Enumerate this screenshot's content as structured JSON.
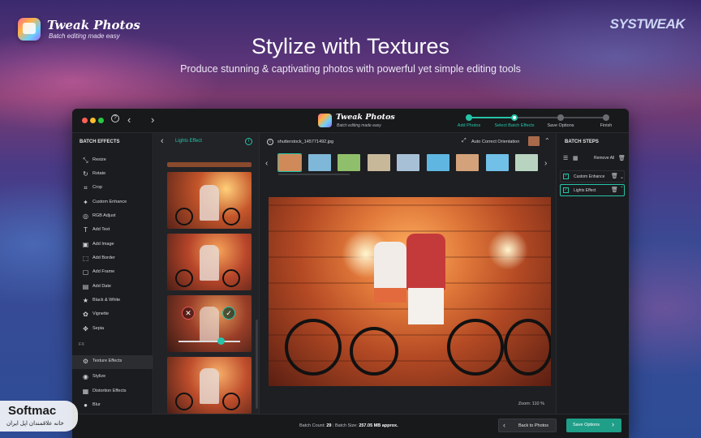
{
  "brand": {
    "name": "Tweak Photos",
    "tagline": "Batch editing made easy",
    "vendor": "SYSTWEAK"
  },
  "hero": {
    "title": "Stylize with Textures",
    "subtitle": "Produce stunning & captivating photos with powerful yet simple editing tools"
  },
  "window": {
    "app_name": "Tweak Photos",
    "app_tagline": "Batch editing made easy",
    "steps": [
      {
        "label": "Add Photos",
        "state": "done"
      },
      {
        "label": "Select Batch Effects",
        "state": "current"
      },
      {
        "label": "Save Options",
        "state": "todo"
      },
      {
        "label": "Finish",
        "state": "todo"
      }
    ],
    "left": {
      "title": "BATCH EFFECTS",
      "tools": [
        {
          "label": "Resize",
          "icon": "resize-icon"
        },
        {
          "label": "Rotate",
          "icon": "rotate-icon"
        },
        {
          "label": "Crop",
          "icon": "crop-icon"
        },
        {
          "label": "Custom Enhance",
          "icon": "enhance-icon"
        },
        {
          "label": "RGB Adjust",
          "icon": "rgb-icon"
        },
        {
          "label": "Add Text",
          "icon": "text-icon"
        },
        {
          "label": "Add Image",
          "icon": "image-icon"
        },
        {
          "label": "Add Border",
          "icon": "border-icon"
        },
        {
          "label": "Add Frame",
          "icon": "frame-icon"
        },
        {
          "label": "Add Date",
          "icon": "calendar-icon"
        },
        {
          "label": "Black & White",
          "icon": "contrast-icon"
        },
        {
          "label": "Vignette",
          "icon": "vignette-icon"
        },
        {
          "label": "Sepia",
          "icon": "sepia-icon"
        }
      ],
      "fx_label": "FX",
      "fx_tools": [
        {
          "label": "Texture Effects",
          "icon": "texture-icon"
        },
        {
          "label": "Stylize",
          "icon": "stylize-icon"
        },
        {
          "label": "Distortion Effects",
          "icon": "distortion-icon"
        },
        {
          "label": "Blur",
          "icon": "blur-icon"
        }
      ]
    },
    "middle": {
      "title": "Lights Effect",
      "selected_index": 2
    },
    "main": {
      "file_name": "shutterstock_145771492.jpg",
      "auto_orientation": "Auto Correct Orientation",
      "zoom": "Zoom: 110 %",
      "strip_count": 9
    },
    "right": {
      "title": "BATCH STEPS",
      "remove_all": "Remove All",
      "items": [
        "Custom Enhance",
        "Lights Effect"
      ]
    },
    "bottom": {
      "batch_count_label": "Batch Count:",
      "batch_count": "29",
      "batch_size_label": "Batch Size:",
      "batch_size": "257.05 MB approx.",
      "back_button": "Back to Photos",
      "save_button": "Save Options"
    }
  },
  "watermark": {
    "name": "Softmac",
    "subtitle": "خانه علاقمندان اپل ایران"
  },
  "colors": {
    "accent": "#25c4a8",
    "close": "#ff5f57",
    "minimize": "#febc2e",
    "maximize": "#28c840"
  }
}
